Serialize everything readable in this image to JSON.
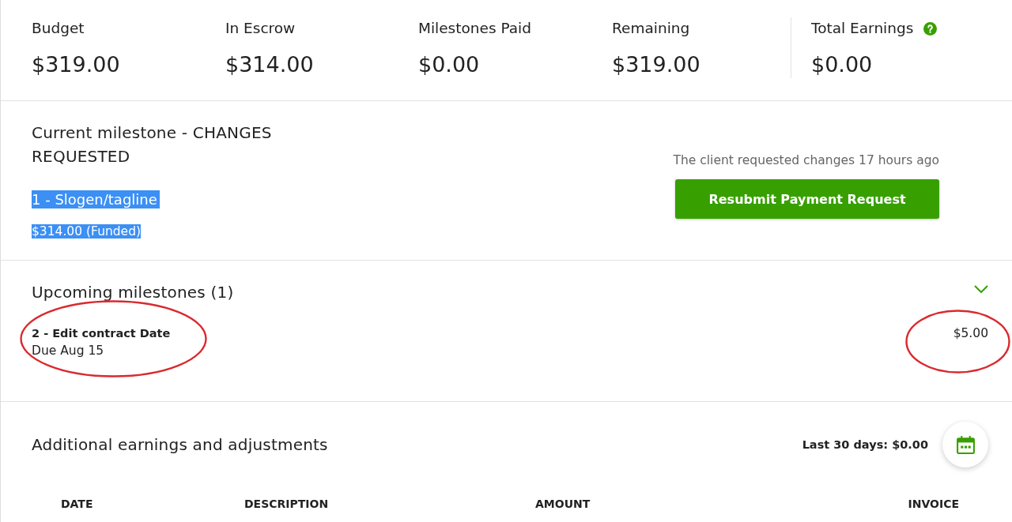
{
  "stats": [
    {
      "label": "Budget",
      "value": "$319.00"
    },
    {
      "label": "In Escrow",
      "value": "$314.00"
    },
    {
      "label": "Milestones Paid",
      "value": "$0.00"
    },
    {
      "label": "Remaining",
      "value": "$319.00"
    }
  ],
  "total_earnings": {
    "label": "Total Earnings",
    "value": "$0.00",
    "help": true
  },
  "current_milestone": {
    "heading": "Current milestone - CHANGES REQUESTED",
    "title": "1 - Slogen/tagline",
    "amount": "$314.00 (Funded)",
    "highlighted": true,
    "status_note": "The client requested changes 17 hours ago",
    "action": "Resubmit Payment Request"
  },
  "upcoming": {
    "heading": "Upcoming milestones (1)",
    "expanded": true,
    "items": [
      {
        "title": "2 - Edit contract Date",
        "due": "Due Aug 15",
        "amount": "$5.00",
        "details_circled": true,
        "amount_circled": true
      }
    ]
  },
  "adjustments": {
    "heading": "Additional earnings and adjustments",
    "period_total": "Last 30 days: $0.00",
    "columns": [
      "DATE",
      "DESCRIPTION",
      "AMOUNT",
      "INVOICE"
    ]
  }
}
